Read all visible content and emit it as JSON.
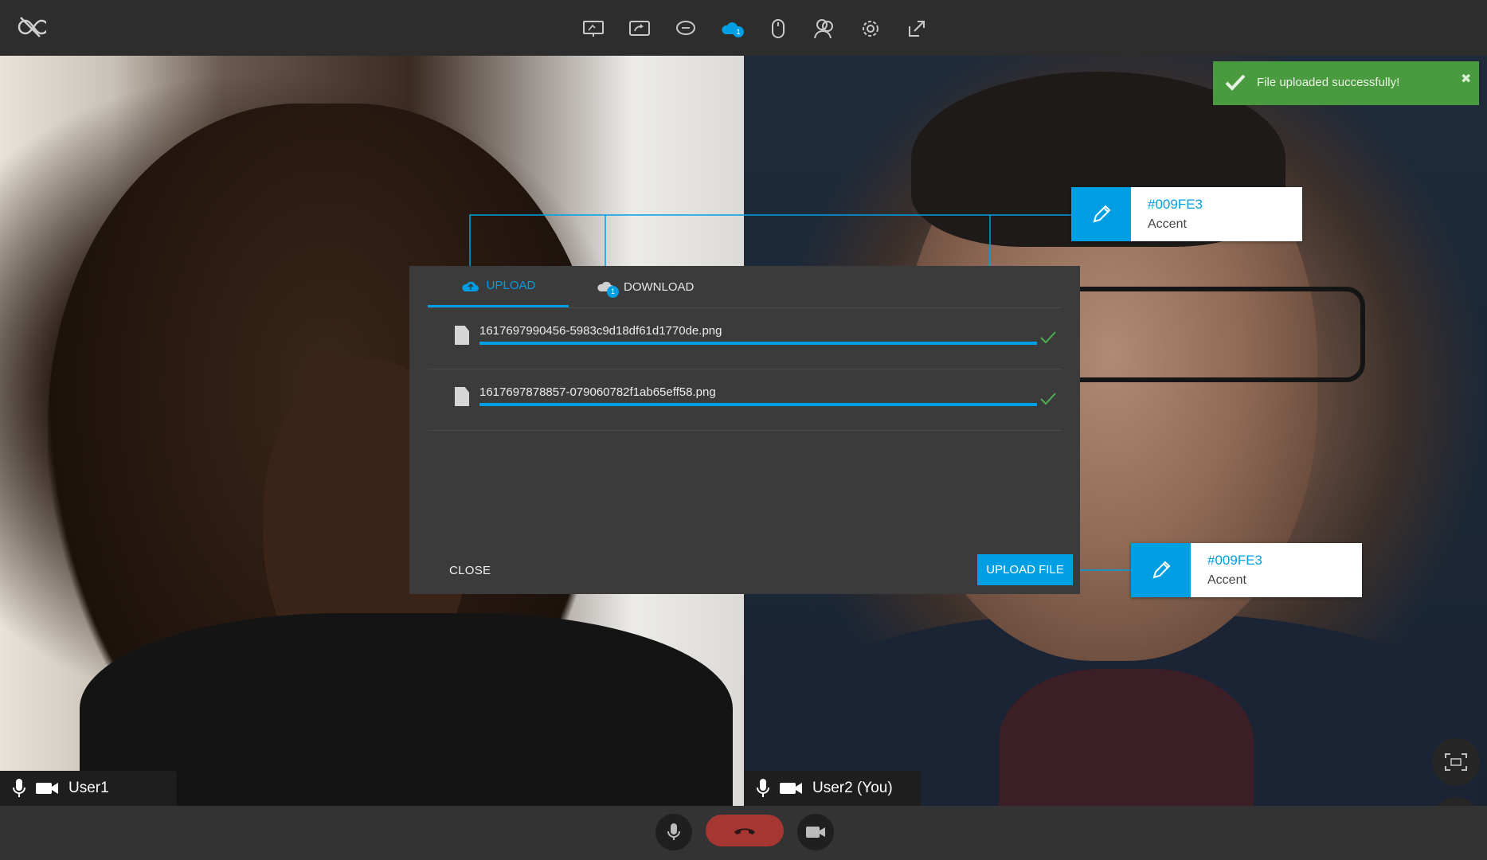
{
  "toolbar": {
    "icons": [
      "whiteboard-icon",
      "screen-share-icon",
      "chat-icon",
      "file-transfer-icon",
      "remote-control-mouse-icon",
      "participants-icon",
      "settings-icon",
      "popout-icon"
    ],
    "file_transfer_badge": "1"
  },
  "toast": {
    "message": "File uploaded successfully!",
    "close": "✖",
    "color": "#4a9b3f"
  },
  "dialog": {
    "tabs": {
      "upload": "UPLOAD",
      "download": "DOWNLOAD",
      "download_badge": "1"
    },
    "files": [
      {
        "name": "1617697990456-5983c9d18df61d1770de.png",
        "progress": 1.0,
        "status": "complete"
      },
      {
        "name": "1617697878857-079060782f1ab65eff58.png",
        "progress": 1.0,
        "status": "complete"
      }
    ],
    "close_label": "CLOSE",
    "upload_label": "UPLOAD FILE"
  },
  "callouts": [
    {
      "hex": "#009FE3",
      "label": "Accent"
    },
    {
      "hex": "#009FE3",
      "label": "Accent"
    }
  ],
  "participants": {
    "left": {
      "name": "User1"
    },
    "right": {
      "name": "User2 (You)"
    }
  },
  "colors": {
    "accent": "#009FE3",
    "hangup": "#a53632",
    "success_check": "#4caf50"
  }
}
